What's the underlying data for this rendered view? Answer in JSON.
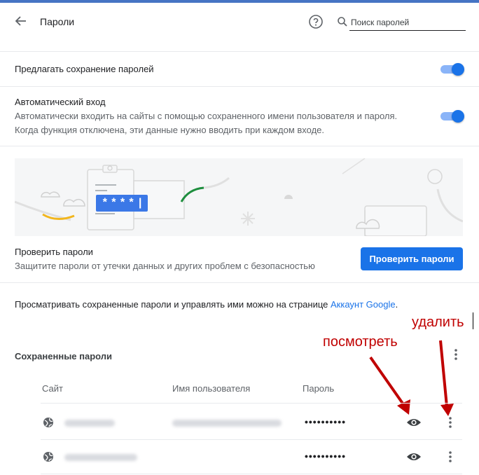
{
  "header": {
    "title": "Пароли",
    "search_placeholder": "Поиск паролей"
  },
  "settings": {
    "offer_save": {
      "label": "Предлагать сохранение паролей",
      "enabled": true
    },
    "auto_signin": {
      "label": "Автоматический вход",
      "description_line1": "Автоматически входить на сайты с помощью сохраненного имени пользователя и пароля.",
      "description_line2": "Когда функция отключена, эти данные нужно вводить при каждом входе.",
      "enabled": true
    }
  },
  "banner": {
    "password_mask": "****|"
  },
  "check": {
    "title": "Проверить пароли",
    "description": "Защитите пароли от утечки данных и других проблем с безопасностью",
    "button_label": "Проверить пароли"
  },
  "manage": {
    "text": "Просматривать сохраненные пароли и управлять ими можно на странице",
    "link": "Аккаунт Google",
    "period": "."
  },
  "saved": {
    "title": "Сохраненные пароли",
    "columns": {
      "site": "Сайт",
      "username": "Имя пользователя",
      "password": "Пароль"
    },
    "rows": [
      {
        "password": "••••••••••"
      },
      {
        "password": "••••••••••"
      }
    ]
  },
  "annotations": {
    "view": "посмотреть",
    "delete": "удалить",
    "color": "#c00000"
  },
  "colors": {
    "accent": "#1a73e8",
    "topbar": "#4674c4"
  }
}
